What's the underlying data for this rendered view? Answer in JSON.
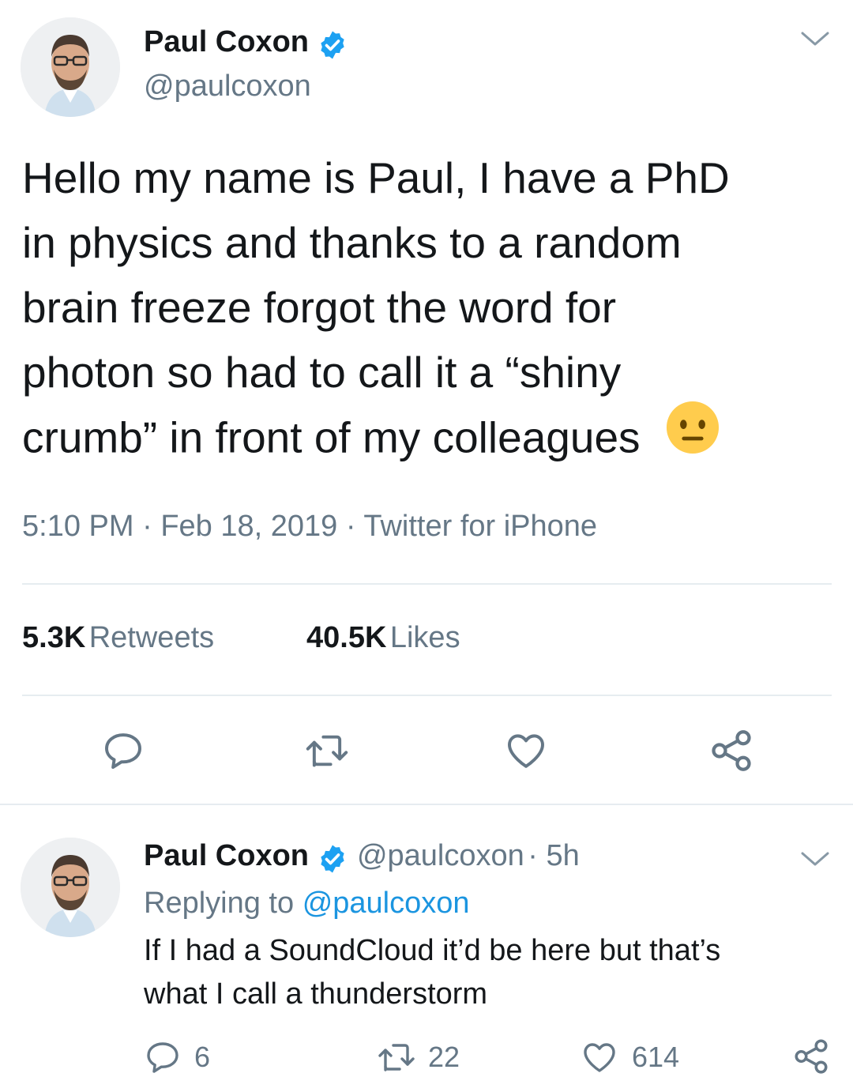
{
  "tweet": {
    "author_name": "Paul Coxon",
    "author_handle": "@paulcoxon",
    "text_lines": [
      "Hello my name is Paul, I have a PhD",
      "in physics and thanks to a random",
      "brain freeze forgot the word for",
      "photon so had to call it a “shiny",
      "crumb” in front of my colleagues"
    ],
    "emoji": "neutral-face-emoji",
    "time": "5:10 PM",
    "date": "Feb 18, 2019",
    "source": "Twitter for iPhone",
    "retweets_count": "5.3K",
    "retweets_label": "Retweets",
    "likes_count": "40.5K",
    "likes_label": "Likes"
  },
  "reply": {
    "author_name": "Paul Coxon",
    "author_handle": "@paulcoxon",
    "age": "5h",
    "replying_prefix": "Replying to",
    "replying_to": "@paulcoxon",
    "text_lines": [
      "If I had a SoundCloud it’d be here but that’s",
      "what I call a thunderstorm"
    ],
    "reply_count": "6",
    "retweet_count": "22",
    "like_count": "614"
  },
  "icons": {
    "verified": "verified-badge-icon",
    "caret": "chevron-down-icon",
    "reply": "reply-icon",
    "retweet": "retweet-icon",
    "like": "heart-icon",
    "share": "share-icon"
  },
  "colors": {
    "verified_blue": "#1da1f2",
    "secondary_text": "#657786",
    "link": "#1b95e0",
    "divider": "#e6ecf0",
    "emoji_yellow": "#ffcc4d"
  }
}
